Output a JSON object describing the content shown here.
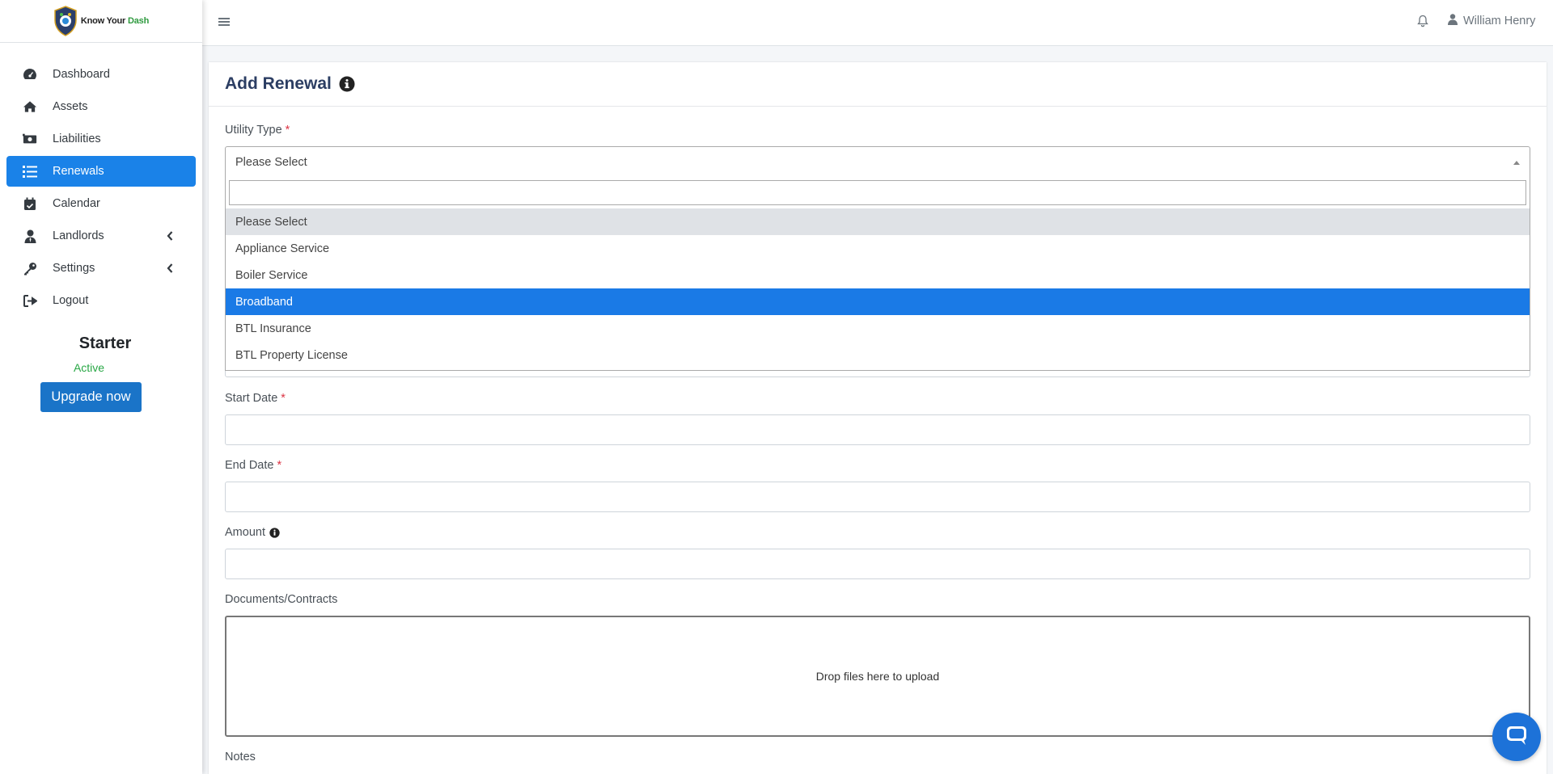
{
  "brand": {
    "name_part1": "Know Your ",
    "name_part2": "Dash"
  },
  "sidebar": {
    "items": [
      {
        "label": "Dashboard",
        "icon": "dashboard-icon"
      },
      {
        "label": "Assets",
        "icon": "home-icon"
      },
      {
        "label": "Liabilities",
        "icon": "money-icon"
      },
      {
        "label": "Renewals",
        "icon": "list-icon"
      },
      {
        "label": "Calendar",
        "icon": "calendar-icon"
      },
      {
        "label": "Landlords",
        "icon": "user-tie-icon"
      },
      {
        "label": "Settings",
        "icon": "key-icon"
      },
      {
        "label": "Logout",
        "icon": "logout-icon"
      }
    ],
    "active_index": 3,
    "plan": {
      "name": "Starter",
      "status": "Active",
      "upgrade_label": "Upgrade now"
    }
  },
  "topbar": {
    "user_name": "William Henry"
  },
  "form": {
    "title": "Add Renewal",
    "utility_type": {
      "label": "Utility Type",
      "required": "*",
      "selected": "Please Select",
      "search_value": "",
      "options": [
        "Please Select",
        "Appliance Service",
        "Boiler Service",
        "Broadband",
        "BTL Insurance",
        "BTL Property License"
      ],
      "hovered_option": "Please Select",
      "highlighted_option": "Broadband"
    },
    "start_date": {
      "label": "Start Date",
      "required": "*",
      "value": ""
    },
    "end_date": {
      "label": "End Date",
      "required": "*",
      "value": ""
    },
    "amount": {
      "label": "Amount",
      "value": ""
    },
    "documents": {
      "label": "Documents/Contracts",
      "dropzone_text": "Drop files here to upload"
    },
    "notes": {
      "label": "Notes"
    }
  },
  "colors": {
    "primary": "#1a82e8",
    "required": "#dc3545",
    "active_status": "#28a745",
    "title": "#2c3e63"
  }
}
